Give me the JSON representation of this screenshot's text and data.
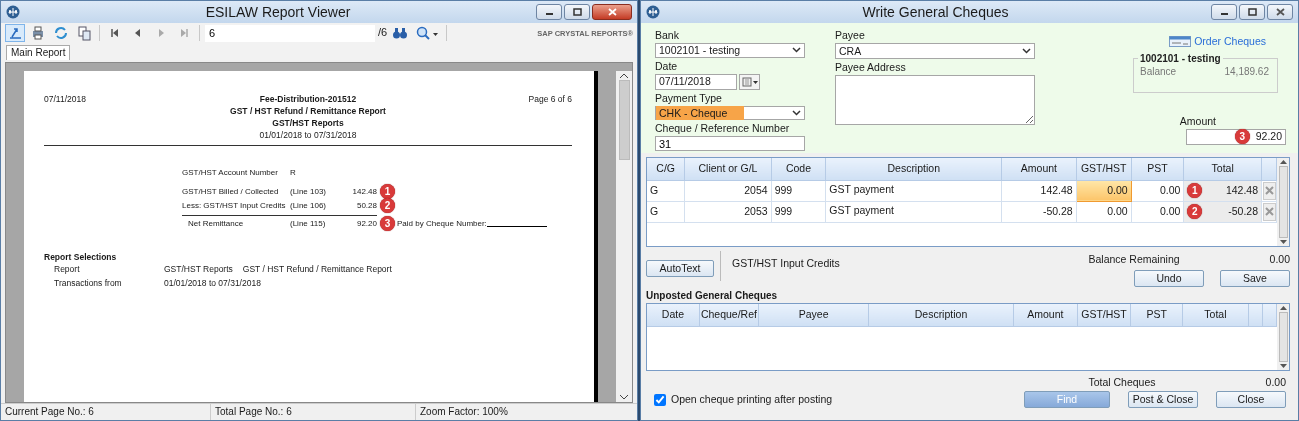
{
  "viewer": {
    "title": "ESILAW Report Viewer",
    "page_field": "6",
    "page_total": "/6",
    "brand": "SAP CRYSTAL REPORTS®",
    "tabs": [
      {
        "label": "Main Report",
        "selected": true
      }
    ],
    "report": {
      "date": "07/11/2018",
      "page": "Page 6 of 6",
      "titles": [
        "Fee-Distribution-201512",
        "GST / HST Refund / Remittance  Report",
        "GST/HST Reports"
      ],
      "range": "01/01/2018 to 07/31/2018",
      "account": {
        "label": "GST/HST Account Number",
        "value": "R"
      },
      "lines": [
        {
          "kind": "item",
          "label": "GST/HST Billed / Collected",
          "line": "(Line 103)",
          "amount": "142.48",
          "marker": "1"
        },
        {
          "kind": "item",
          "label": "Less: GST/HST Input Credits",
          "line": "(Line 106)",
          "amount": "50.28",
          "marker": "2"
        },
        {
          "kind": "net",
          "label": "Net Remittance",
          "line": "(Line 115)",
          "amount": "92.20",
          "marker": "3",
          "note": "Paid by Cheque Number:"
        }
      ],
      "selections_title": "Report Selections",
      "selections": [
        {
          "label": "Report",
          "values": [
            "GST/HST Reports",
            "GST / HST Refund / Remittance  Report"
          ]
        },
        {
          "label": "Transactions from",
          "values": [
            "01/01/2018 to 07/31/2018"
          ]
        }
      ]
    },
    "status_bar": [
      "Current Page No.: 6",
      "Total Page No.: 6",
      "Zoom Factor: 100%"
    ]
  },
  "cheques": {
    "title": "Write General Cheques",
    "bank": {
      "label": "Bank",
      "value": "1002101 - testing"
    },
    "date": {
      "label": "Date",
      "value": "07/11/2018"
    },
    "payment_type": {
      "label": "Payment Type",
      "value": "CHK - Cheque",
      "highlighted": true
    },
    "reference": {
      "label": "Cheque / Reference Number",
      "value": "31"
    },
    "payee": {
      "label": "Payee",
      "value": "CRA"
    },
    "payee_address": {
      "label": "Payee Address"
    },
    "order_link": "Order Cheques",
    "account_box": {
      "title": "1002101 - testing",
      "label": "Balance",
      "value": "14,189.62"
    },
    "amount": {
      "label": "Amount",
      "value": "92.20",
      "marker": "3"
    },
    "lines_table": {
      "columns": [
        "C/G",
        "Client or G/L",
        "Code",
        "Description",
        "Amount",
        "GST/HST",
        "PST",
        "Total"
      ],
      "rows": [
        {
          "cells": [
            "G",
            "2054",
            "999",
            "GST payment",
            "142.48",
            "0.00",
            "0.00",
            "142.48"
          ],
          "gst_focused": true,
          "marker": "1"
        },
        {
          "cells": [
            "G",
            "2053",
            "999",
            "GST payment",
            "-50.28",
            "0.00",
            "0.00",
            "-50.28"
          ],
          "gst_focused": false,
          "marker": "2"
        }
      ]
    },
    "autotext_button": "AutoText",
    "description_note": "GST/HST Input Credits",
    "balance_remaining": {
      "label": "Balance Remaining",
      "value": "0.00"
    },
    "edit_buttons": [
      "Undo",
      "Save"
    ],
    "unposted": {
      "title": "Unposted General Cheques",
      "columns": [
        "Date",
        "Cheque/Ref",
        "Payee",
        "Description",
        "Amount",
        "GST/HST",
        "PST",
        "Total"
      ]
    },
    "total_cheques": {
      "label": "Total Cheques",
      "value": "0.00"
    },
    "print_after": {
      "label": "Open cheque printing after posting",
      "checked": true
    },
    "bottom_buttons": [
      {
        "label": "Find",
        "default": true
      },
      {
        "label": "Post & Close",
        "default": false
      },
      {
        "label": "Close",
        "default": false
      }
    ]
  }
}
